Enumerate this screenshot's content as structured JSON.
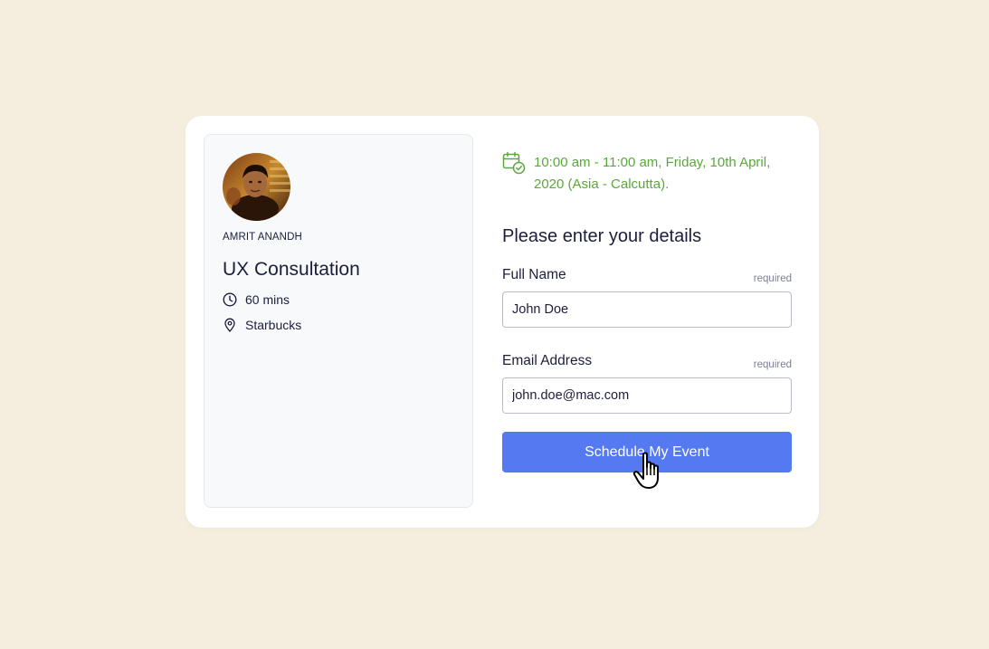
{
  "host": {
    "name": "AMRIT ANANDH",
    "avatar": "host-avatar-photo"
  },
  "event": {
    "title": "UX Consultation",
    "duration": "60 mins",
    "duration_icon": "clock-icon",
    "location": "Starbucks",
    "location_icon": "map-pin-icon"
  },
  "schedule": {
    "datetime": "10:00 am - 11:00 am, Friday, 10th April, 2020 (Asia - Calcutta).",
    "icon": "calendar-check-icon"
  },
  "form": {
    "heading": "Please enter your details",
    "name_label": "Full Name",
    "name_required": "required",
    "name_value": "John Doe",
    "email_label": "Email Address",
    "email_required": "required",
    "email_value": "john.doe@mac.com",
    "submit_label": "Schedule My Event"
  },
  "colors": {
    "background": "#f5eedf",
    "card": "#ffffff",
    "accent_green": "#5aa83b",
    "button_blue": "#5479f0",
    "text_dark": "#1b1f3b"
  }
}
